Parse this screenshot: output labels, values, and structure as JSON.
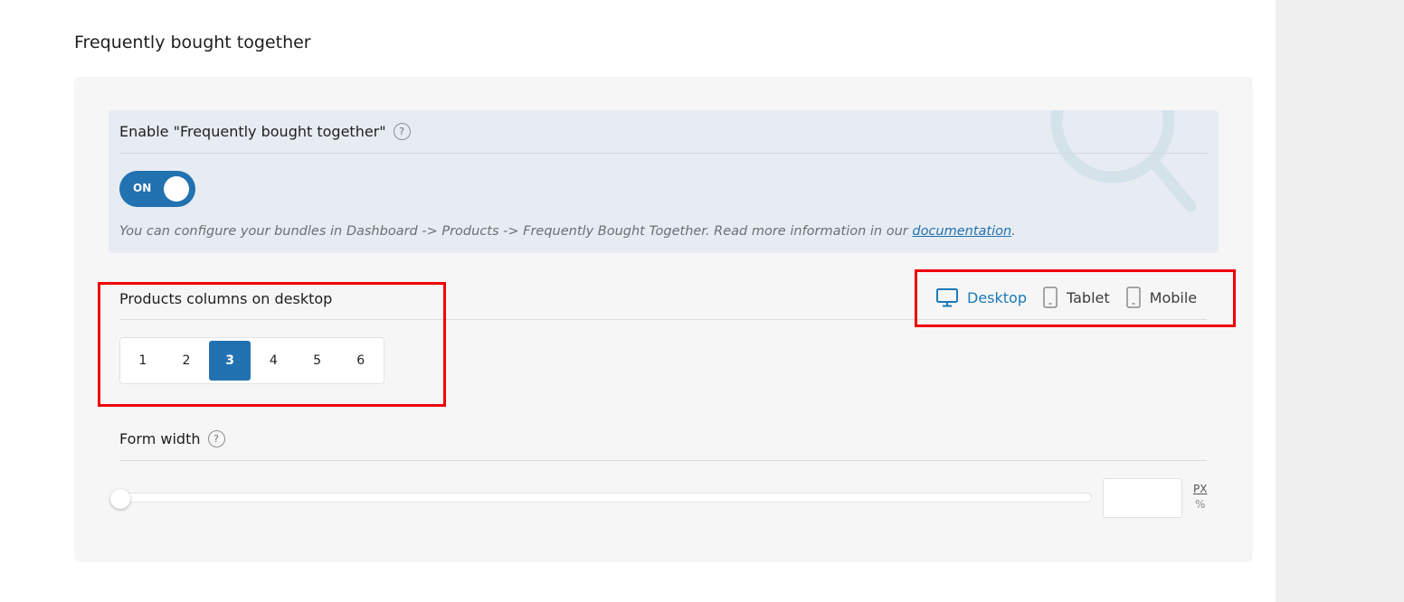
{
  "page": {
    "title": "Frequently bought together"
  },
  "enable": {
    "label": "Enable \"Frequently bought together\"",
    "help": "?",
    "toggle_label": "ON",
    "desc_text": "You can configure your bundles in Dashboard -> Products -> Frequently Bought Together. Read more information in our ",
    "desc_link": "documentation",
    "desc_end": "."
  },
  "columns": {
    "label": "Products columns on desktop",
    "options": [
      "1",
      "2",
      "3",
      "4",
      "5",
      "6"
    ],
    "selected": "3"
  },
  "devices": {
    "desktop": "Desktop",
    "tablet": "Tablet",
    "mobile": "Mobile",
    "active": "Desktop"
  },
  "form_width": {
    "label": "Form width",
    "help": "?",
    "value": "",
    "unit_px": "PX",
    "unit_pct": "%"
  },
  "colors": {
    "accent": "#2271b1",
    "active_tab": "#1a7ab8",
    "highlight": "#ee0000"
  },
  "icons": {
    "desktop": "monitor-icon",
    "tablet": "tablet-icon",
    "mobile": "mobile-icon",
    "watermark": "magnifier-icon"
  }
}
